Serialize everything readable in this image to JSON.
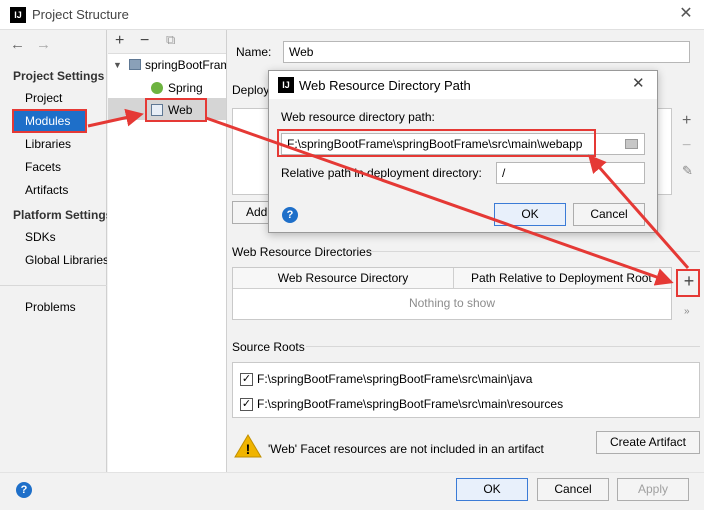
{
  "window": {
    "title": "Project Structure",
    "app_icon": "IJ"
  },
  "nav": {
    "back": "←",
    "forward": "→",
    "project_settings": "Project Settings",
    "items1": [
      "Project",
      "Modules",
      "Libraries",
      "Facets",
      "Artifacts"
    ],
    "platform_settings": "Platform Settings",
    "items2": [
      "SDKs",
      "Global Libraries"
    ],
    "problems": "Problems"
  },
  "tree": {
    "toolbar": [
      "+",
      "−",
      "⧉"
    ],
    "root": "springBootFrame",
    "children": [
      "Spring",
      "Web"
    ]
  },
  "main": {
    "name_label": "Name:",
    "name_value": "Web",
    "deployment_label": "Deployment Descriptors",
    "add_button": "Add Application Server specific descriptor...",
    "web_resource_dirs_label": "Web Resource Directories",
    "col1": "Web Resource Directory",
    "col2": "Path Relative to Deployment Root",
    "empty_text": "Nothing to show",
    "source_roots_label": "Source Roots",
    "source_roots": [
      "F:\\springBootFrame\\springBootFrame\\src\\main\\java",
      "F:\\springBootFrame\\springBootFrame\\src\\main\\resources"
    ],
    "warning_text": "'Web' Facet resources are not included in an artifact",
    "create_artifact": "Create Artifact"
  },
  "dialog": {
    "title": "Web Resource Directory Path",
    "path_label": "Web resource directory path:",
    "path_value": "F:\\springBootFrame\\springBootFrame\\src\\main\\webapp",
    "rel_label": "Relative path in deployment directory:",
    "rel_value": "/",
    "ok": "OK",
    "cancel": "Cancel"
  },
  "footer": {
    "ok": "OK",
    "cancel": "Cancel",
    "apply": "Apply"
  },
  "colors": {
    "accent": "#1e6fc9",
    "annotation": "#e53935"
  }
}
